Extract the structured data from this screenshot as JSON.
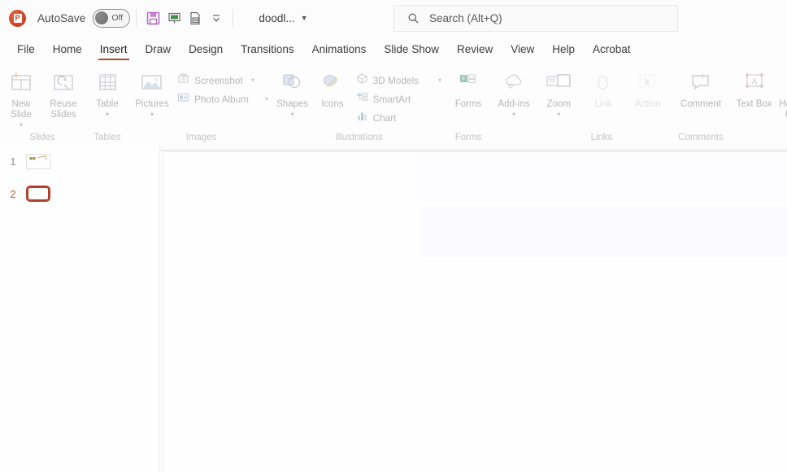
{
  "app": {
    "name": "PowerPoint",
    "logo_glyph": "P",
    "accent_color": "#b7472a",
    "selection_color": "#b1402b"
  },
  "titlebar": {
    "autosave_label": "AutoSave",
    "autosave_state": "Off",
    "document_name": "doodl...",
    "quick_access": [
      {
        "name": "save-icon",
        "tooltip": "Save"
      },
      {
        "name": "start-presentation-icon",
        "tooltip": "Start From Beginning"
      },
      {
        "name": "print-preview-icon",
        "tooltip": "Print Preview and Print"
      },
      {
        "name": "customize-quick-access-toolbar-icon",
        "tooltip": "Customize Quick Access Toolbar"
      }
    ]
  },
  "search": {
    "placeholder": "Search (Alt+Q)",
    "icon": "search-icon"
  },
  "tabs": [
    {
      "label": "File",
      "active": false
    },
    {
      "label": "Home",
      "active": false
    },
    {
      "label": "Insert",
      "active": true
    },
    {
      "label": "Draw",
      "active": false
    },
    {
      "label": "Design",
      "active": false
    },
    {
      "label": "Transitions",
      "active": false
    },
    {
      "label": "Animations",
      "active": false
    },
    {
      "label": "Slide Show",
      "active": false
    },
    {
      "label": "Review",
      "active": false
    },
    {
      "label": "View",
      "active": false
    },
    {
      "label": "Help",
      "active": false
    },
    {
      "label": "Acrobat",
      "active": false
    }
  ],
  "ribbon": {
    "groups": [
      {
        "label": "Slides",
        "big": [
          {
            "label": "New Slide",
            "icon": "new-slide-icon",
            "chevron": true
          },
          {
            "label": "Reuse Slides",
            "icon": "reuse-slides-icon",
            "chevron": false
          }
        ],
        "small": []
      },
      {
        "label": "Tables",
        "big": [
          {
            "label": "Table",
            "icon": "table-icon",
            "chevron": true
          }
        ],
        "small": []
      },
      {
        "label": "Images",
        "big": [
          {
            "label": "Pictures",
            "icon": "pictures-icon",
            "chevron": true
          }
        ],
        "small": [
          {
            "label": "Screenshot",
            "icon": "screenshot-icon",
            "chevron": true,
            "disabled": false
          },
          {
            "label": "Photo Album",
            "icon": "photo-album-icon",
            "chevron": true,
            "disabled": false
          }
        ]
      },
      {
        "label": "Illustrations",
        "big": [
          {
            "label": "Shapes",
            "icon": "shapes-icon",
            "chevron": true
          },
          {
            "label": "Icons",
            "icon": "icons-icon",
            "chevron": false
          }
        ],
        "small": [
          {
            "label": "3D Models",
            "icon": "3d-models-icon",
            "chevron": true,
            "disabled": false
          },
          {
            "label": "SmartArt",
            "icon": "smartart-icon",
            "chevron": false,
            "disabled": false
          },
          {
            "label": "Chart",
            "icon": "chart-icon",
            "chevron": false,
            "disabled": false
          }
        ]
      },
      {
        "label": "Forms",
        "big": [
          {
            "label": "Forms",
            "icon": "forms-icon",
            "chevron": false
          }
        ],
        "small": []
      },
      {
        "label": "",
        "big": [
          {
            "label": "Add-ins",
            "icon": "add-ins-icon",
            "chevron": true
          }
        ],
        "small": []
      },
      {
        "label": "Links",
        "big": [
          {
            "label": "Zoom",
            "icon": "zoom-icon",
            "chevron": true
          },
          {
            "label": "Link",
            "icon": "link-icon",
            "chevron": false,
            "disabled": true
          },
          {
            "label": "Action",
            "icon": "action-icon",
            "chevron": false,
            "disabled": true
          }
        ],
        "small": []
      },
      {
        "label": "Comments",
        "big": [
          {
            "label": "Comment",
            "icon": "comment-icon",
            "chevron": false
          }
        ],
        "small": []
      },
      {
        "label": "",
        "big": [
          {
            "label": "Text Box",
            "icon": "text-box-icon",
            "chevron": false
          },
          {
            "label": "Header & Footer",
            "icon": "header-footer-icon",
            "chevron": false
          }
        ],
        "small": []
      }
    ]
  },
  "slides_panel": {
    "slides": [
      {
        "number": "1",
        "selected": false
      },
      {
        "number": "2",
        "selected": true
      }
    ]
  },
  "canvas": {
    "slide_content": ""
  }
}
